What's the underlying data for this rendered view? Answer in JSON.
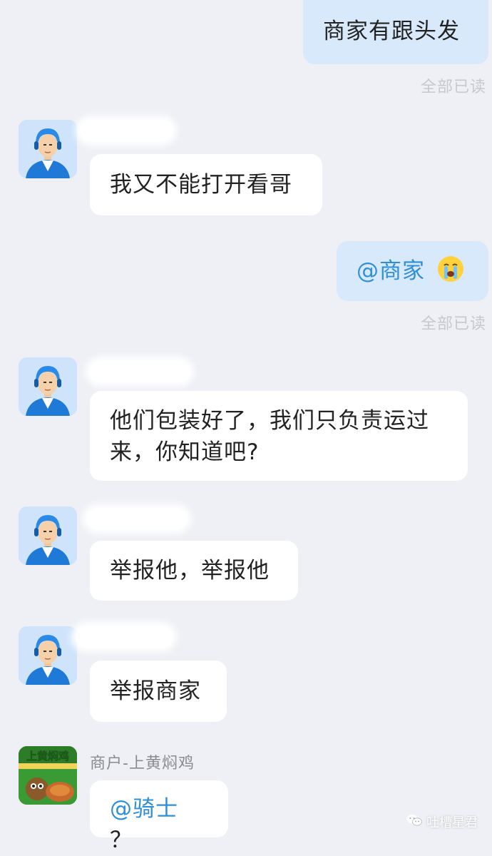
{
  "colors": {
    "background": "#eef0f5",
    "incoming_bubble": "#ffffff",
    "outgoing_bubble": "#d8e9fb",
    "mention": "#2e8fd8",
    "read_receipt": "#c8c8cc"
  },
  "messages": [
    {
      "id": "m1",
      "direction": "out",
      "text": "商家有跟头发",
      "receipt": "全部已读"
    },
    {
      "id": "m2",
      "direction": "in",
      "sender": "rider",
      "avatar_icon": "rider-avatar-icon",
      "text": "我又不能打开看哥"
    },
    {
      "id": "m3",
      "direction": "out",
      "mention": "@商家",
      "emoji_icon": "crying-face-emoji-icon",
      "receipt": "全部已读"
    },
    {
      "id": "m4",
      "direction": "in",
      "sender": "rider",
      "avatar_icon": "rider-avatar-icon",
      "line1": "他们包装好了，我们只负责运过",
      "line2": "来，你知道吧?"
    },
    {
      "id": "m5",
      "direction": "in",
      "sender": "rider",
      "avatar_icon": "rider-avatar-icon",
      "text": "举报他，举报他"
    },
    {
      "id": "m6",
      "direction": "in",
      "sender": "rider",
      "avatar_icon": "rider-avatar-icon",
      "text": "举报商家"
    },
    {
      "id": "m7",
      "direction": "in",
      "sender_name": "商户-上黄焖鸡",
      "avatar_icon": "merchant-logo-avatar-icon",
      "avatar_logo_text": "上黄焖鸡",
      "mention": "@骑士",
      "text": "？"
    }
  ],
  "watermark": {
    "icon": "wechat-icon",
    "text": "吐槽星君"
  }
}
